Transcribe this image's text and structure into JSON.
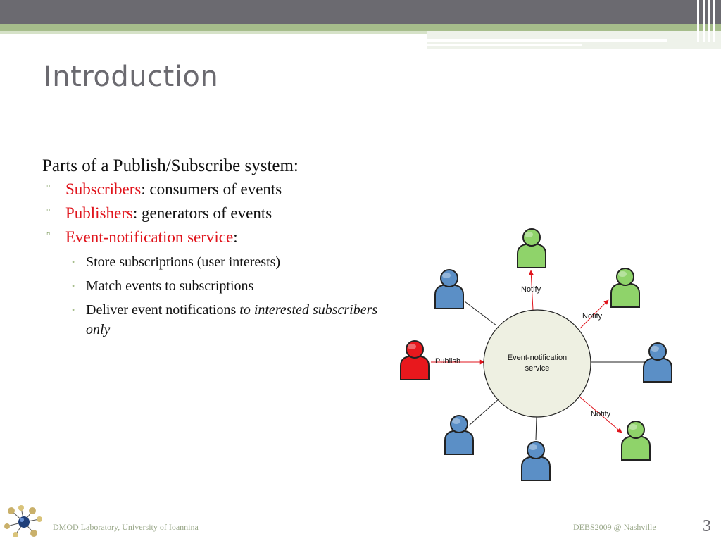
{
  "slide": {
    "title": "Introduction",
    "lead": "Parts of a Publish/Subscribe system:",
    "bullets": [
      {
        "term": "Subscribers",
        "rest": ": consumers of events"
      },
      {
        "term": "Publishers",
        "rest": ": generators of events"
      },
      {
        "term": "Event-notification service",
        "rest": ":"
      }
    ],
    "sub_bullets": [
      {
        "text": "Store subscriptions (user interests)"
      },
      {
        "text": "Match events to subscriptions"
      },
      {
        "text": "Deliver event notifications ",
        "italic": "to interested subscribers only"
      }
    ]
  },
  "diagram": {
    "center_label_line1": "Event-notification",
    "center_label_line2": "service",
    "publish_label": "Publish",
    "notify_labels": [
      "Notify",
      "Notify",
      "Notify"
    ],
    "colors": {
      "subscriber": "#5b8fc6",
      "notified": "#8fd36a",
      "publisher": "#e8181d",
      "service_fill": "#eef0e2",
      "arrow": "#e0141c"
    }
  },
  "footer": {
    "left": "DMOD Laboratory, University of Ioannina",
    "right": "DEBS2009 @ Nashville",
    "page_number": "3"
  },
  "theme": {
    "accent_green": "#a6bd8b",
    "highlight_red": "#e0141c",
    "title_gray": "#6b6a70"
  }
}
